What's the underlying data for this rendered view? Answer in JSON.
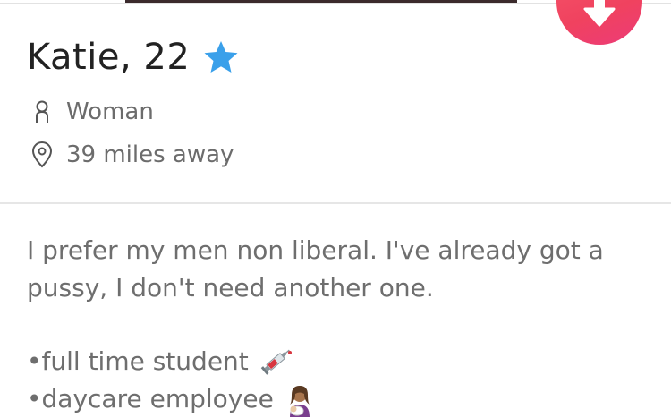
{
  "profile": {
    "name_age": "Katie, 22",
    "gender": "Woman",
    "distance": "39 miles away"
  },
  "bio": {
    "paragraph": "I prefer my men non liberal. I've already got a pussy, I don't need another one.",
    "bullets": [
      {
        "text": "•full time student",
        "emoji": "syringe-emoji"
      },
      {
        "text": "•daycare employee",
        "emoji": "breastfeeding-emoji"
      }
    ]
  },
  "icons": {
    "verified": "star-icon",
    "gender": "person-icon",
    "distance": "location-pin-icon",
    "collapse": "arrow-down-icon"
  },
  "colors": {
    "accent": "#f0425f",
    "verified": "#3aa0ea",
    "text_primary": "#222222",
    "text_secondary": "#6c6c6c"
  }
}
